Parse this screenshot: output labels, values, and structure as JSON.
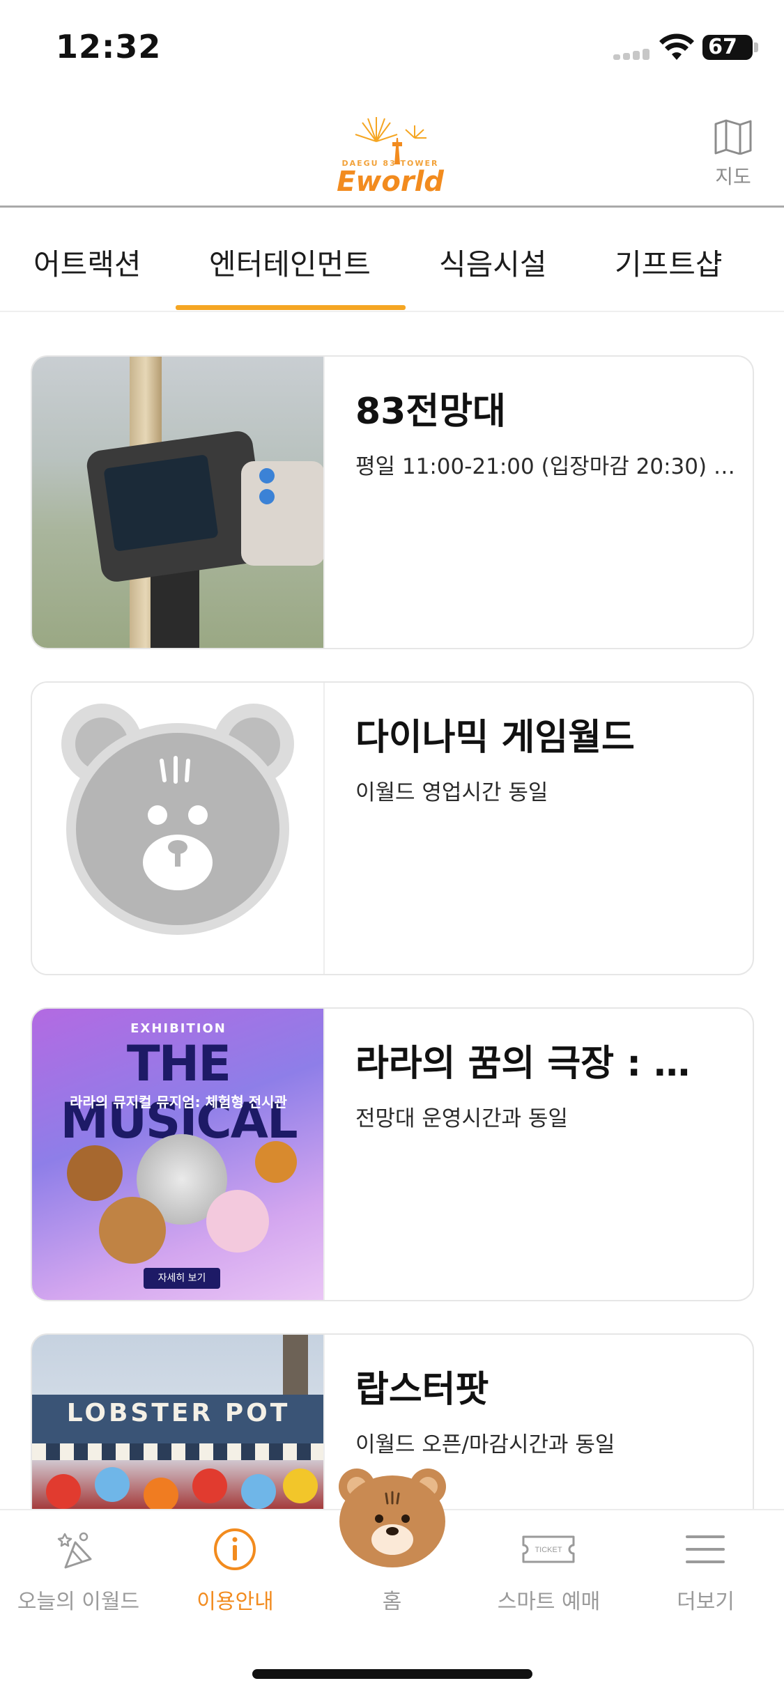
{
  "status_bar": {
    "time": "12:32",
    "battery": "67"
  },
  "header": {
    "logo_subtitle": "DAEGU 83 TOWER",
    "logo_text": "Eworld",
    "map_label": "지도"
  },
  "tabs": [
    {
      "label": "어트랙션"
    },
    {
      "label": "엔터테인먼트"
    },
    {
      "label": "식음시설"
    },
    {
      "label": "기프트샵"
    }
  ],
  "active_tab": "엔터테인먼트",
  "cards": [
    {
      "title": "83전망대",
      "subtitle": "평일 11:00-21:00 (입장마감 20:30) …"
    },
    {
      "title": "다이나믹 게임월드",
      "subtitle": "이월드 영업시간 동일"
    },
    {
      "title": "라라의 꿈의 극장 : …",
      "subtitle": "전망대 운영시간과 동일"
    },
    {
      "title": "랍스터팟",
      "subtitle": "이월드 오픈/마감시간과 동일"
    }
  ],
  "card_images": {
    "musical_small": "EXHIBITION",
    "musical_title": "THE MUSICAL",
    "musical_sub": "라라의 뮤지컬 뮤지엄: 체험형 전시관",
    "musical_button": "자세히 보기",
    "lobster_sign": "LOBSTER POT"
  },
  "bottom_nav": [
    {
      "label": "오늘의 이월드",
      "icon": "party-icon"
    },
    {
      "label": "이용안내",
      "icon": "info-icon"
    },
    {
      "label": "홈",
      "icon": "bear-home-icon"
    },
    {
      "label": "스마트 예매",
      "icon": "ticket-icon"
    },
    {
      "label": "더보기",
      "icon": "menu-icon"
    }
  ],
  "active_nav": "이용안내",
  "colors": {
    "accent": "#f28b1e",
    "tab_indicator": "#f5a623",
    "inactive": "#9a9a9a"
  }
}
